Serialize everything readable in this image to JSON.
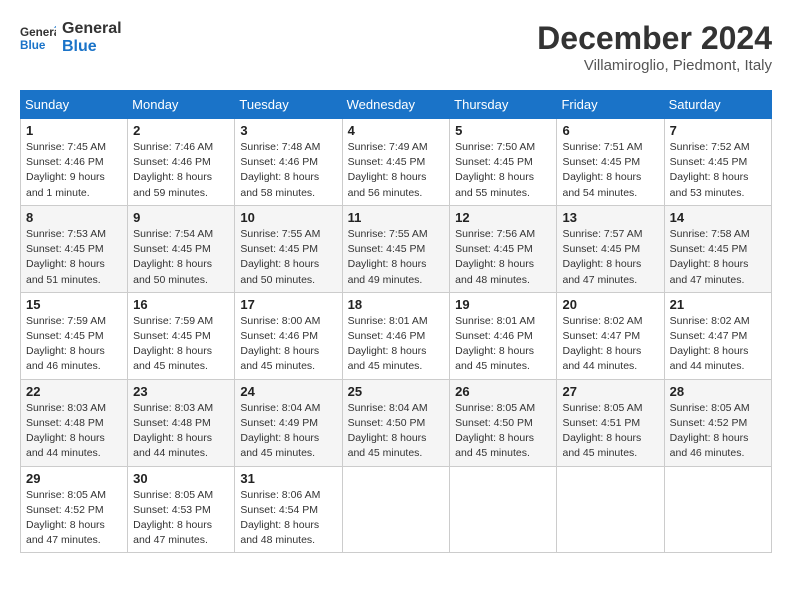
{
  "header": {
    "logo_line1": "General",
    "logo_line2": "Blue",
    "month_title": "December 2024",
    "location": "Villamiroglio, Piedmont, Italy"
  },
  "days_of_week": [
    "Sunday",
    "Monday",
    "Tuesday",
    "Wednesday",
    "Thursday",
    "Friday",
    "Saturday"
  ],
  "weeks": [
    [
      {
        "day": "1",
        "info": "Sunrise: 7:45 AM\nSunset: 4:46 PM\nDaylight: 9 hours\nand 1 minute."
      },
      {
        "day": "2",
        "info": "Sunrise: 7:46 AM\nSunset: 4:46 PM\nDaylight: 8 hours\nand 59 minutes."
      },
      {
        "day": "3",
        "info": "Sunrise: 7:48 AM\nSunset: 4:46 PM\nDaylight: 8 hours\nand 58 minutes."
      },
      {
        "day": "4",
        "info": "Sunrise: 7:49 AM\nSunset: 4:45 PM\nDaylight: 8 hours\nand 56 minutes."
      },
      {
        "day": "5",
        "info": "Sunrise: 7:50 AM\nSunset: 4:45 PM\nDaylight: 8 hours\nand 55 minutes."
      },
      {
        "day": "6",
        "info": "Sunrise: 7:51 AM\nSunset: 4:45 PM\nDaylight: 8 hours\nand 54 minutes."
      },
      {
        "day": "7",
        "info": "Sunrise: 7:52 AM\nSunset: 4:45 PM\nDaylight: 8 hours\nand 53 minutes."
      }
    ],
    [
      {
        "day": "8",
        "info": "Sunrise: 7:53 AM\nSunset: 4:45 PM\nDaylight: 8 hours\nand 51 minutes."
      },
      {
        "day": "9",
        "info": "Sunrise: 7:54 AM\nSunset: 4:45 PM\nDaylight: 8 hours\nand 50 minutes."
      },
      {
        "day": "10",
        "info": "Sunrise: 7:55 AM\nSunset: 4:45 PM\nDaylight: 8 hours\nand 50 minutes."
      },
      {
        "day": "11",
        "info": "Sunrise: 7:55 AM\nSunset: 4:45 PM\nDaylight: 8 hours\nand 49 minutes."
      },
      {
        "day": "12",
        "info": "Sunrise: 7:56 AM\nSunset: 4:45 PM\nDaylight: 8 hours\nand 48 minutes."
      },
      {
        "day": "13",
        "info": "Sunrise: 7:57 AM\nSunset: 4:45 PM\nDaylight: 8 hours\nand 47 minutes."
      },
      {
        "day": "14",
        "info": "Sunrise: 7:58 AM\nSunset: 4:45 PM\nDaylight: 8 hours\nand 47 minutes."
      }
    ],
    [
      {
        "day": "15",
        "info": "Sunrise: 7:59 AM\nSunset: 4:45 PM\nDaylight: 8 hours\nand 46 minutes."
      },
      {
        "day": "16",
        "info": "Sunrise: 7:59 AM\nSunset: 4:45 PM\nDaylight: 8 hours\nand 45 minutes."
      },
      {
        "day": "17",
        "info": "Sunrise: 8:00 AM\nSunset: 4:46 PM\nDaylight: 8 hours\nand 45 minutes."
      },
      {
        "day": "18",
        "info": "Sunrise: 8:01 AM\nSunset: 4:46 PM\nDaylight: 8 hours\nand 45 minutes."
      },
      {
        "day": "19",
        "info": "Sunrise: 8:01 AM\nSunset: 4:46 PM\nDaylight: 8 hours\nand 45 minutes."
      },
      {
        "day": "20",
        "info": "Sunrise: 8:02 AM\nSunset: 4:47 PM\nDaylight: 8 hours\nand 44 minutes."
      },
      {
        "day": "21",
        "info": "Sunrise: 8:02 AM\nSunset: 4:47 PM\nDaylight: 8 hours\nand 44 minutes."
      }
    ],
    [
      {
        "day": "22",
        "info": "Sunrise: 8:03 AM\nSunset: 4:48 PM\nDaylight: 8 hours\nand 44 minutes."
      },
      {
        "day": "23",
        "info": "Sunrise: 8:03 AM\nSunset: 4:48 PM\nDaylight: 8 hours\nand 44 minutes."
      },
      {
        "day": "24",
        "info": "Sunrise: 8:04 AM\nSunset: 4:49 PM\nDaylight: 8 hours\nand 45 minutes."
      },
      {
        "day": "25",
        "info": "Sunrise: 8:04 AM\nSunset: 4:50 PM\nDaylight: 8 hours\nand 45 minutes."
      },
      {
        "day": "26",
        "info": "Sunrise: 8:05 AM\nSunset: 4:50 PM\nDaylight: 8 hours\nand 45 minutes."
      },
      {
        "day": "27",
        "info": "Sunrise: 8:05 AM\nSunset: 4:51 PM\nDaylight: 8 hours\nand 45 minutes."
      },
      {
        "day": "28",
        "info": "Sunrise: 8:05 AM\nSunset: 4:52 PM\nDaylight: 8 hours\nand 46 minutes."
      }
    ],
    [
      {
        "day": "29",
        "info": "Sunrise: 8:05 AM\nSunset: 4:52 PM\nDaylight: 8 hours\nand 47 minutes."
      },
      {
        "day": "30",
        "info": "Sunrise: 8:05 AM\nSunset: 4:53 PM\nDaylight: 8 hours\nand 47 minutes."
      },
      {
        "day": "31",
        "info": "Sunrise: 8:06 AM\nSunset: 4:54 PM\nDaylight: 8 hours\nand 48 minutes."
      },
      {
        "day": "",
        "info": ""
      },
      {
        "day": "",
        "info": ""
      },
      {
        "day": "",
        "info": ""
      },
      {
        "day": "",
        "info": ""
      }
    ]
  ]
}
